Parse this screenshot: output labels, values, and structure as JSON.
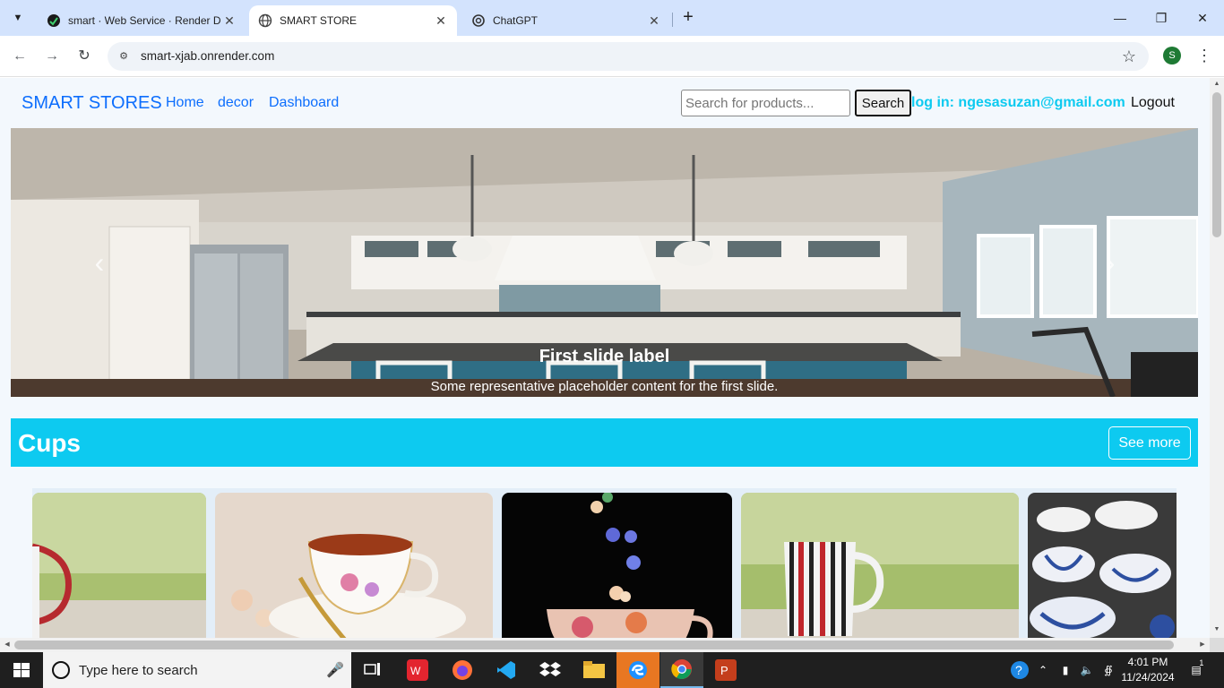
{
  "browser": {
    "tabs": [
      {
        "title": "smart · Web Service · Render D",
        "active": false
      },
      {
        "title": "SMART STORE",
        "active": true
      },
      {
        "title": "ChatGPT",
        "active": false
      }
    ],
    "url": "smart-xjab.onrender.com",
    "profile_initial": "S"
  },
  "site": {
    "brand": "SMART STORES",
    "nav": [
      "Home",
      "decor",
      "Dashboard"
    ],
    "search_placeholder": "Search for products...",
    "search_button": "Search",
    "login_text": "log in: ngesasuzan@gmail.com",
    "logout": "Logout"
  },
  "carousel": {
    "title": "First slide label",
    "text": "Some representative placeholder content for the first slide.",
    "slide_count": 3,
    "active_index": 0
  },
  "section": {
    "title": "Cups",
    "see_more": "See more"
  },
  "taskbar": {
    "search_placeholder": "Type here to search",
    "time": "4:01 PM",
    "date": "11/24/2024",
    "notification_count": "1"
  },
  "colors": {
    "primary": "#0d6efd",
    "info": "#0dcaf0",
    "page_bg": "#f3f8fd"
  }
}
